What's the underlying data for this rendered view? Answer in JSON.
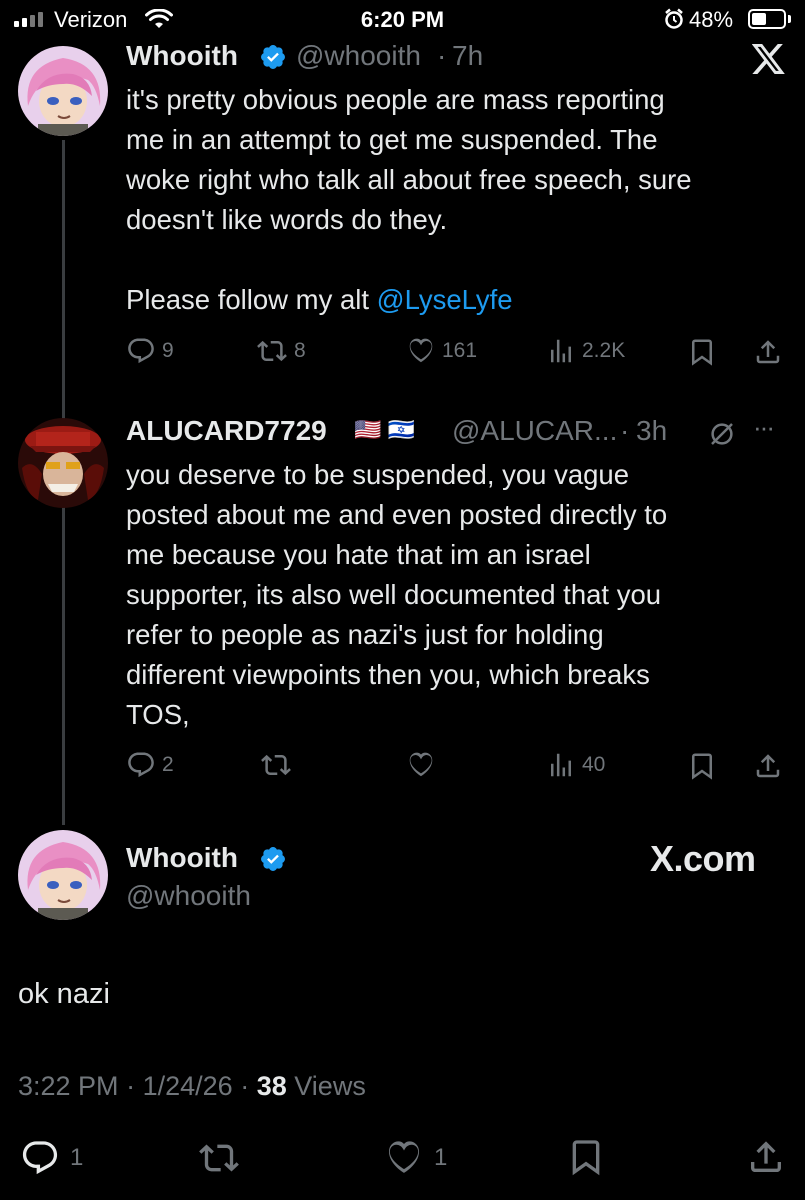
{
  "status_bar": {
    "carrier": "Verizon",
    "time": "6:20 PM",
    "battery": "48%",
    "battery_level": 0.48
  },
  "tweet1": {
    "name": "Whooith",
    "handle": "@whooith",
    "sep": "·",
    "age": "7h",
    "text_line1": "it's pretty obvious people are mass reporting",
    "text_line2": "me in an attempt to get me suspended. The",
    "text_line3": "woke right who talk all about free speech, sure",
    "text_line4": "doesn't like words do they.",
    "follow_prefix": "Please follow my alt ",
    "mention": "@LyseLyfe",
    "replies": "9",
    "reposts": "8",
    "likes": "161",
    "views": "2.2K"
  },
  "tweet2": {
    "name": "ALUCARD7729",
    "flags": "🇺🇸 🇮🇱",
    "handle": "@ALUCAR...",
    "sep": "·",
    "age": "3h",
    "more": "···",
    "text_lines": [
      "you deserve to be suspended, you vague",
      "posted about me and even posted directly to",
      "me because you hate that im an israel",
      "supporter, its also well documented that you",
      "refer to people as nazi's just for holding",
      "different viewpoints then you, which breaks",
      "TOS,"
    ],
    "replies": "2",
    "reposts": "",
    "likes": "",
    "views": "40"
  },
  "main": {
    "name": "Whooith",
    "handle": "@whooith",
    "brand": "X.com",
    "text": "ok nazi",
    "time": "3:22 PM",
    "date": "1/24/26",
    "sep": "·",
    "views_count": "38",
    "views_label": "Views",
    "replies": "1",
    "likes": "1"
  },
  "colors": {
    "background": "#000000",
    "text": "#e7e9ea",
    "muted": "#71767b",
    "link": "#1d9bf0",
    "verified": "#1d9bf0"
  },
  "icons": [
    "signal-icon",
    "wifi-icon",
    "alarm-icon",
    "battery-icon",
    "x-logo-icon",
    "verified-icon",
    "reply-icon",
    "repost-icon",
    "like-icon",
    "views-icon",
    "bookmark-icon",
    "share-icon",
    "hide-icon",
    "more-icon"
  ]
}
